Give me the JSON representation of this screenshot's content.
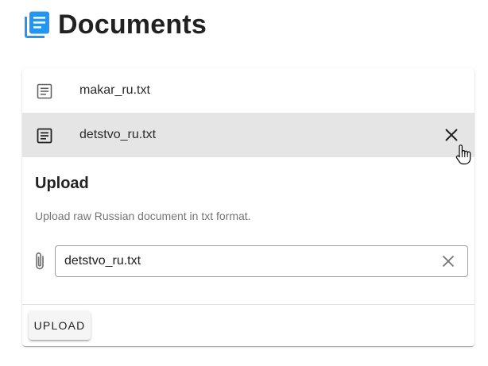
{
  "header": {
    "title": "Documents",
    "icon": "library-books-icon",
    "accent": "#2196f3"
  },
  "documents": [
    {
      "name": "makar_ru.txt",
      "icon": "document-icon",
      "selected": false
    },
    {
      "name": "detstvo_ru.txt",
      "icon": "document-icon",
      "selected": true,
      "action_icon": "close-icon"
    }
  ],
  "upload": {
    "title": "Upload",
    "description": "Upload raw Russian document in txt format.",
    "file_value": "detstvo_ru.txt",
    "attach_icon": "paperclip-icon",
    "clear_icon": "close-icon",
    "button_label": "UPLOAD"
  },
  "colors": {
    "selected_row": "#e5e5e5",
    "muted_text": "#757575"
  }
}
